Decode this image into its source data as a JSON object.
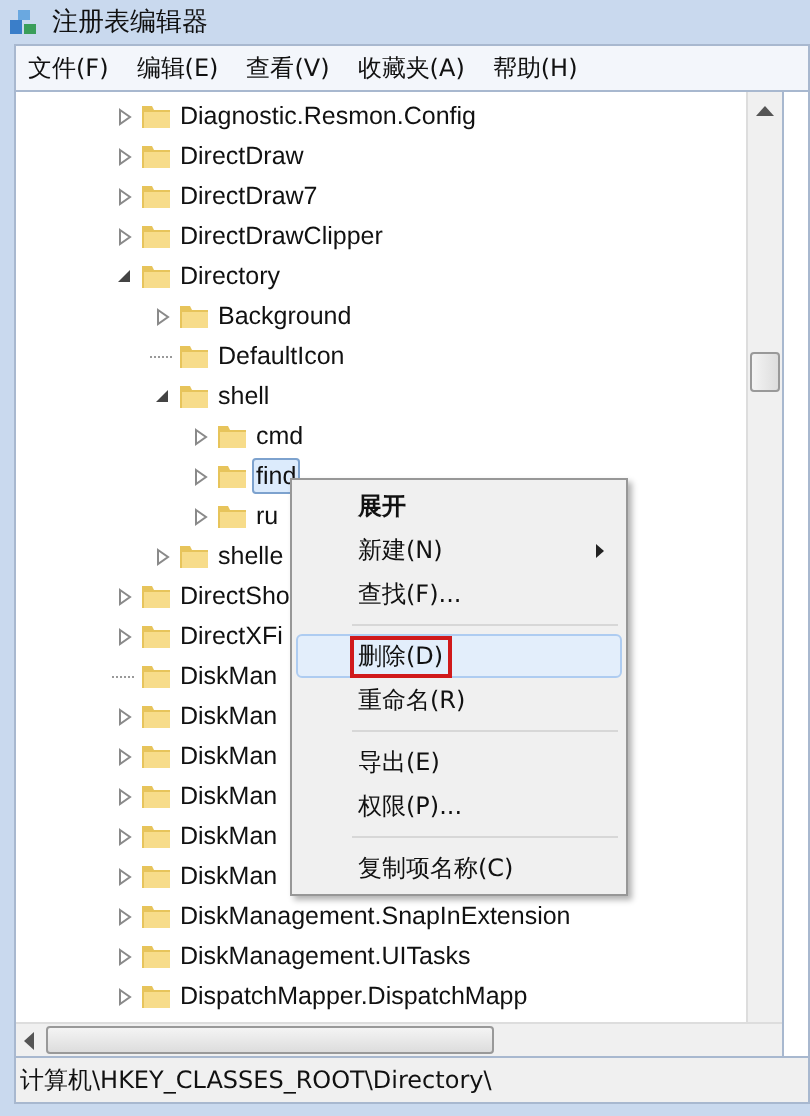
{
  "window": {
    "title": "注册表编辑器"
  },
  "menu_bar": [
    {
      "label": "文件(F)"
    },
    {
      "label": "编辑(E)"
    },
    {
      "label": "查看(V)"
    },
    {
      "label": "收藏夹(A)"
    },
    {
      "label": "帮助(H)"
    }
  ],
  "tree": [
    {
      "label": "Diagnostic.Resmon.Config",
      "expandable": true,
      "expanded": false,
      "selected": false
    },
    {
      "label": "DirectDraw",
      "expandable": true,
      "expanded": false,
      "selected": false
    },
    {
      "label": "DirectDraw7",
      "expandable": true,
      "expanded": false,
      "selected": false
    },
    {
      "label": "DirectDrawClipper",
      "expandable": true,
      "expanded": false,
      "selected": false
    },
    {
      "label": "Directory",
      "expandable": true,
      "expanded": true,
      "selected": false,
      "children": [
        {
          "label": "Background",
          "expandable": true,
          "expanded": false,
          "selected": false
        },
        {
          "label": "DefaultIcon",
          "expandable": false,
          "selected": false
        },
        {
          "label": "shell",
          "expandable": true,
          "expanded": true,
          "selected": false,
          "children": [
            {
              "label": "cmd",
              "expandable": true,
              "expanded": false,
              "selected": false
            },
            {
              "label": "find",
              "expandable": true,
              "expanded": false,
              "selected": true
            },
            {
              "label": "ru",
              "expandable": true,
              "expanded": false,
              "selected": false
            }
          ]
        },
        {
          "label": "shelle",
          "expandable": true,
          "expanded": false,
          "selected": false
        }
      ]
    },
    {
      "label": "DirectSho",
      "expandable": true,
      "expanded": false,
      "selected": false
    },
    {
      "label": "DirectXFi",
      "expandable": true,
      "expanded": false,
      "selected": false
    },
    {
      "label": "DiskMan",
      "expandable": false,
      "selected": false
    },
    {
      "label": "DiskMan",
      "expandable": true,
      "expanded": false,
      "selected": false
    },
    {
      "label": "DiskMan",
      "expandable": true,
      "expanded": false,
      "selected": false
    },
    {
      "label": "DiskMan",
      "expandable": true,
      "expanded": false,
      "selected": false
    },
    {
      "label": "DiskMan",
      "expandable": true,
      "expanded": false,
      "selected": false
    },
    {
      "label": "DiskMan",
      "expandable": true,
      "expanded": false,
      "selected": false
    },
    {
      "label": "DiskManagement.SnapInExtension",
      "expandable": true,
      "expanded": false,
      "selected": false
    },
    {
      "label": "DiskManagement.UITasks",
      "expandable": true,
      "expanded": false,
      "selected": false
    },
    {
      "label": "DispatchMapper.DispatchMapp",
      "expandable": true,
      "expanded": false,
      "selected": false
    }
  ],
  "context_menu": [
    {
      "kind": "item",
      "label": "展开",
      "bold": true,
      "hovered": false,
      "outlined": false
    },
    {
      "kind": "submenu",
      "label": "新建(N)",
      "bold": false,
      "hovered": false,
      "outlined": false
    },
    {
      "kind": "item",
      "label": "查找(F)...",
      "bold": false,
      "hovered": false,
      "outlined": false
    },
    {
      "kind": "separator"
    },
    {
      "kind": "item",
      "label": "删除(D)",
      "bold": false,
      "hovered": true,
      "outlined": true
    },
    {
      "kind": "item",
      "label": "重命名(R)",
      "bold": false,
      "hovered": false,
      "outlined": false
    },
    {
      "kind": "separator"
    },
    {
      "kind": "item",
      "label": "导出(E)",
      "bold": false,
      "hovered": false,
      "outlined": false
    },
    {
      "kind": "item",
      "label": "权限(P)...",
      "bold": false,
      "hovered": false,
      "outlined": false
    },
    {
      "kind": "separator"
    },
    {
      "kind": "item",
      "label": "复制项名称(C)",
      "bold": false,
      "hovered": false,
      "outlined": false
    }
  ],
  "status_bar": {
    "path": "计算机\\HKEY_CLASSES_ROOT\\Directory\\"
  }
}
